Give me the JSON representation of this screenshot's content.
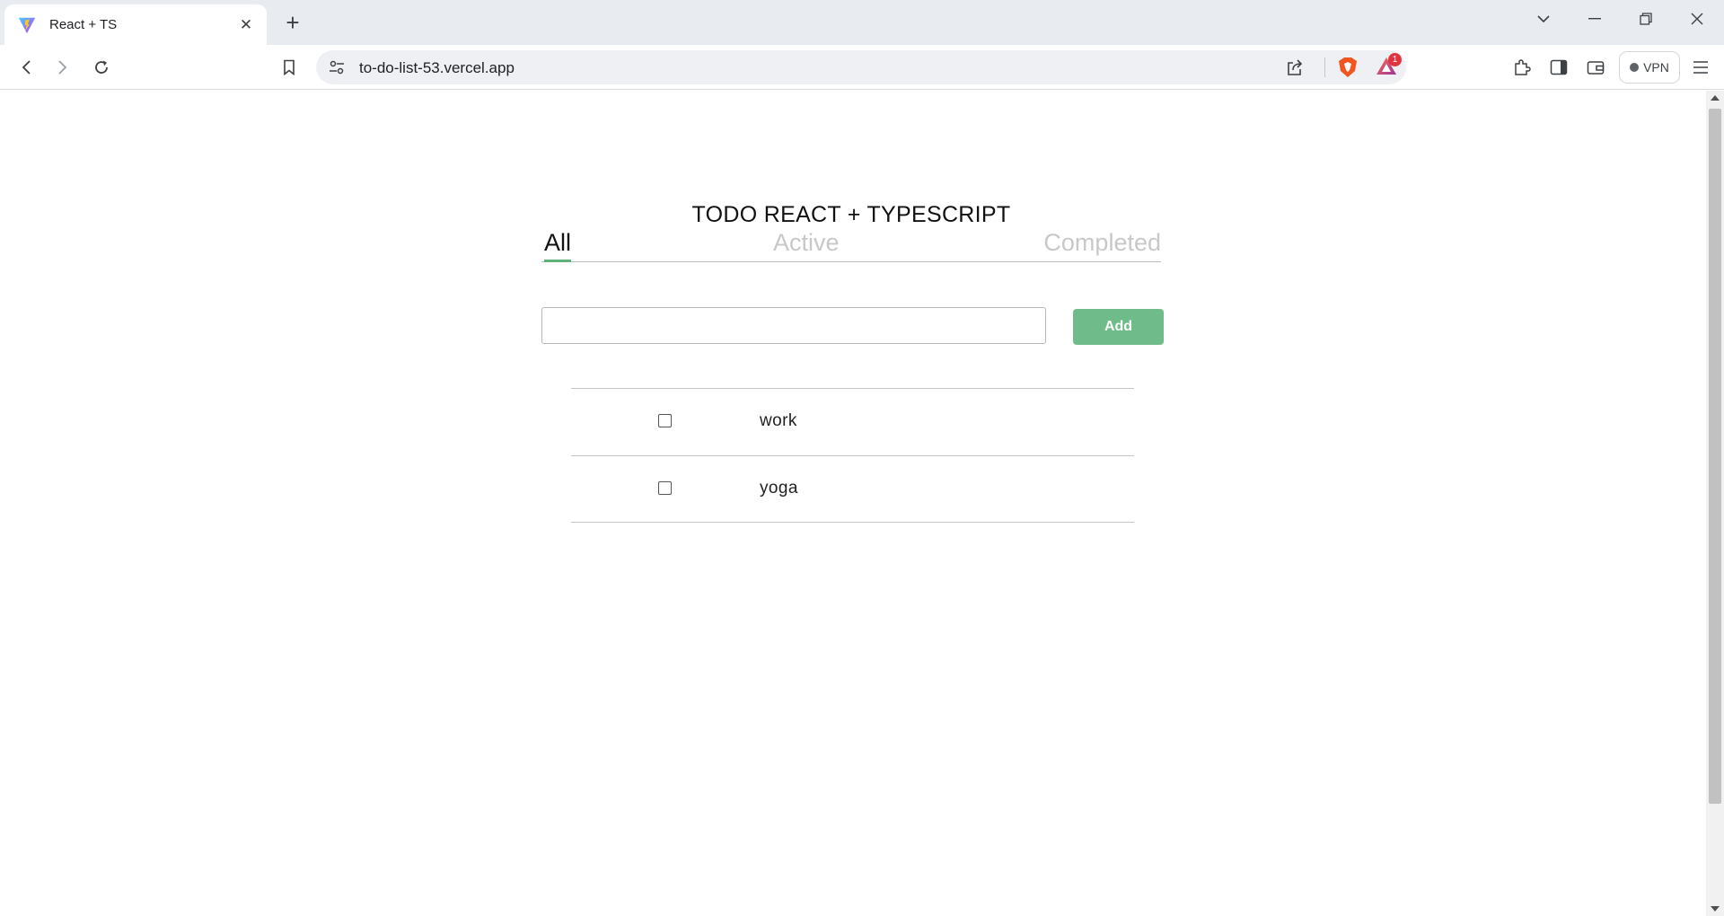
{
  "browser": {
    "tab": {
      "title": "React + TS"
    },
    "address": {
      "url": "to-do-list-53.vercel.app"
    },
    "notification_count": "1",
    "vpn_label": "VPN"
  },
  "app": {
    "title": "TODO REACT + TYPESCRIPT",
    "filters": [
      {
        "label": "All",
        "selected": true
      },
      {
        "label": "Active",
        "selected": false
      },
      {
        "label": "Completed",
        "selected": false
      }
    ],
    "input": {
      "value": "",
      "placeholder": ""
    },
    "add_label": "Add",
    "todos": [
      {
        "text": "work",
        "checked": false
      },
      {
        "text": "yoga",
        "checked": false
      }
    ]
  },
  "colors": {
    "accent_green": "#6fbb89",
    "tab_underline": "#5fb37a",
    "inactive_filter": "#c8c8c8"
  }
}
